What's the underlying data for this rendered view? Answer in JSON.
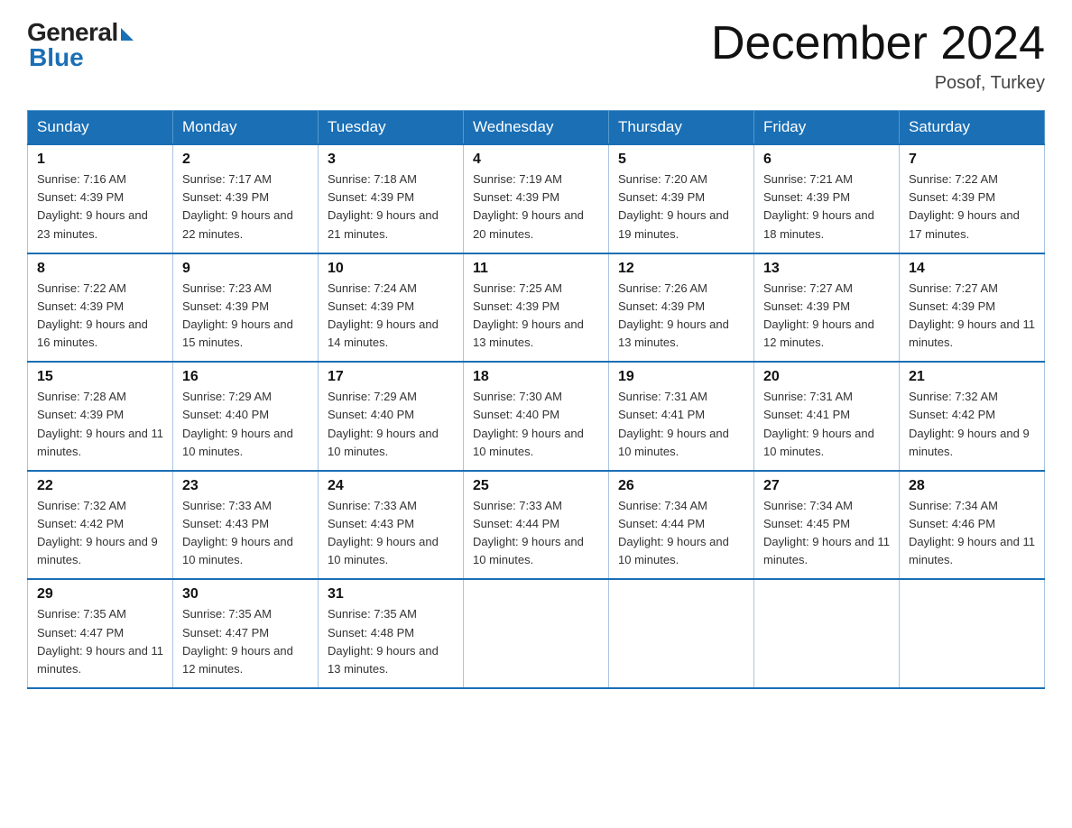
{
  "header": {
    "logo_general": "General",
    "logo_blue": "Blue",
    "month_title": "December 2024",
    "location": "Posof, Turkey"
  },
  "days_of_week": [
    "Sunday",
    "Monday",
    "Tuesday",
    "Wednesday",
    "Thursday",
    "Friday",
    "Saturday"
  ],
  "weeks": [
    [
      {
        "day": "1",
        "sunrise": "7:16 AM",
        "sunset": "4:39 PM",
        "daylight": "9 hours and 23 minutes."
      },
      {
        "day": "2",
        "sunrise": "7:17 AM",
        "sunset": "4:39 PM",
        "daylight": "9 hours and 22 minutes."
      },
      {
        "day": "3",
        "sunrise": "7:18 AM",
        "sunset": "4:39 PM",
        "daylight": "9 hours and 21 minutes."
      },
      {
        "day": "4",
        "sunrise": "7:19 AM",
        "sunset": "4:39 PM",
        "daylight": "9 hours and 20 minutes."
      },
      {
        "day": "5",
        "sunrise": "7:20 AM",
        "sunset": "4:39 PM",
        "daylight": "9 hours and 19 minutes."
      },
      {
        "day": "6",
        "sunrise": "7:21 AM",
        "sunset": "4:39 PM",
        "daylight": "9 hours and 18 minutes."
      },
      {
        "day": "7",
        "sunrise": "7:22 AM",
        "sunset": "4:39 PM",
        "daylight": "9 hours and 17 minutes."
      }
    ],
    [
      {
        "day": "8",
        "sunrise": "7:22 AM",
        "sunset": "4:39 PM",
        "daylight": "9 hours and 16 minutes."
      },
      {
        "day": "9",
        "sunrise": "7:23 AM",
        "sunset": "4:39 PM",
        "daylight": "9 hours and 15 minutes."
      },
      {
        "day": "10",
        "sunrise": "7:24 AM",
        "sunset": "4:39 PM",
        "daylight": "9 hours and 14 minutes."
      },
      {
        "day": "11",
        "sunrise": "7:25 AM",
        "sunset": "4:39 PM",
        "daylight": "9 hours and 13 minutes."
      },
      {
        "day": "12",
        "sunrise": "7:26 AM",
        "sunset": "4:39 PM",
        "daylight": "9 hours and 13 minutes."
      },
      {
        "day": "13",
        "sunrise": "7:27 AM",
        "sunset": "4:39 PM",
        "daylight": "9 hours and 12 minutes."
      },
      {
        "day": "14",
        "sunrise": "7:27 AM",
        "sunset": "4:39 PM",
        "daylight": "9 hours and 11 minutes."
      }
    ],
    [
      {
        "day": "15",
        "sunrise": "7:28 AM",
        "sunset": "4:39 PM",
        "daylight": "9 hours and 11 minutes."
      },
      {
        "day": "16",
        "sunrise": "7:29 AM",
        "sunset": "4:40 PM",
        "daylight": "9 hours and 10 minutes."
      },
      {
        "day": "17",
        "sunrise": "7:29 AM",
        "sunset": "4:40 PM",
        "daylight": "9 hours and 10 minutes."
      },
      {
        "day": "18",
        "sunrise": "7:30 AM",
        "sunset": "4:40 PM",
        "daylight": "9 hours and 10 minutes."
      },
      {
        "day": "19",
        "sunrise": "7:31 AM",
        "sunset": "4:41 PM",
        "daylight": "9 hours and 10 minutes."
      },
      {
        "day": "20",
        "sunrise": "7:31 AM",
        "sunset": "4:41 PM",
        "daylight": "9 hours and 10 minutes."
      },
      {
        "day": "21",
        "sunrise": "7:32 AM",
        "sunset": "4:42 PM",
        "daylight": "9 hours and 9 minutes."
      }
    ],
    [
      {
        "day": "22",
        "sunrise": "7:32 AM",
        "sunset": "4:42 PM",
        "daylight": "9 hours and 9 minutes."
      },
      {
        "day": "23",
        "sunrise": "7:33 AM",
        "sunset": "4:43 PM",
        "daylight": "9 hours and 10 minutes."
      },
      {
        "day": "24",
        "sunrise": "7:33 AM",
        "sunset": "4:43 PM",
        "daylight": "9 hours and 10 minutes."
      },
      {
        "day": "25",
        "sunrise": "7:33 AM",
        "sunset": "4:44 PM",
        "daylight": "9 hours and 10 minutes."
      },
      {
        "day": "26",
        "sunrise": "7:34 AM",
        "sunset": "4:44 PM",
        "daylight": "9 hours and 10 minutes."
      },
      {
        "day": "27",
        "sunrise": "7:34 AM",
        "sunset": "4:45 PM",
        "daylight": "9 hours and 11 minutes."
      },
      {
        "day": "28",
        "sunrise": "7:34 AM",
        "sunset": "4:46 PM",
        "daylight": "9 hours and 11 minutes."
      }
    ],
    [
      {
        "day": "29",
        "sunrise": "7:35 AM",
        "sunset": "4:47 PM",
        "daylight": "9 hours and 11 minutes."
      },
      {
        "day": "30",
        "sunrise": "7:35 AM",
        "sunset": "4:47 PM",
        "daylight": "9 hours and 12 minutes."
      },
      {
        "day": "31",
        "sunrise": "7:35 AM",
        "sunset": "4:48 PM",
        "daylight": "9 hours and 13 minutes."
      },
      null,
      null,
      null,
      null
    ]
  ]
}
